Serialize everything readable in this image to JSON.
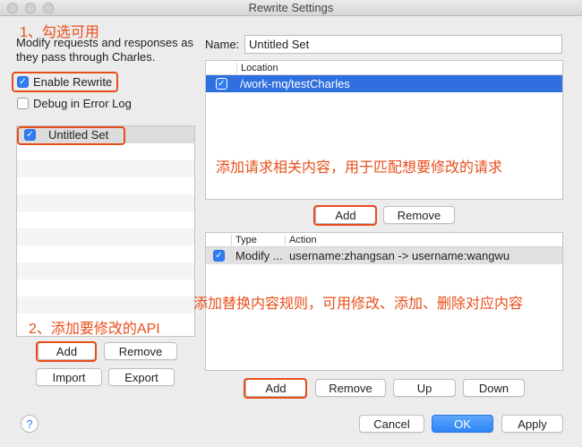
{
  "window": {
    "title": "Rewrite Settings"
  },
  "left": {
    "description": "Modify requests and responses as they pass through Charles.",
    "enable_rewrite": {
      "label": "Enable Rewrite",
      "checked": true
    },
    "debug_log": {
      "label": "Debug in Error Log",
      "checked": false
    },
    "sets": [
      {
        "label": "Untitled Set",
        "checked": true
      }
    ],
    "buttons": {
      "add": "Add",
      "remove": "Remove",
      "import": "Import",
      "export": "Export"
    }
  },
  "right": {
    "name_label": "Name:",
    "name_value": "Untitled Set",
    "locations": {
      "header": "Location",
      "rows": [
        {
          "checked": true,
          "location": "/work-mq/testCharles"
        }
      ],
      "buttons": {
        "add": "Add",
        "remove": "Remove"
      }
    },
    "rules": {
      "headers": {
        "type": "Type",
        "action": "Action"
      },
      "rows": [
        {
          "checked": true,
          "type": "Modify ...",
          "action": "username:zhangsan -> username:wangwu"
        }
      ],
      "buttons": {
        "add": "Add",
        "remove": "Remove",
        "up": "Up",
        "down": "Down"
      }
    }
  },
  "footer": {
    "help": "?",
    "cancel": "Cancel",
    "ok": "OK",
    "apply": "Apply"
  },
  "annotations": {
    "step1": "1、勾选可用",
    "step2": "2、添加要修改的API",
    "location_note": "添加请求相关内容，用于匹配想要修改的请求",
    "rules_note": "添加替换内容规则，可用修改、添加、删除对应内容"
  },
  "colors": {
    "annotation": "#e84e1b",
    "selection": "#2f6fe0",
    "primary": "#2d85f5"
  }
}
